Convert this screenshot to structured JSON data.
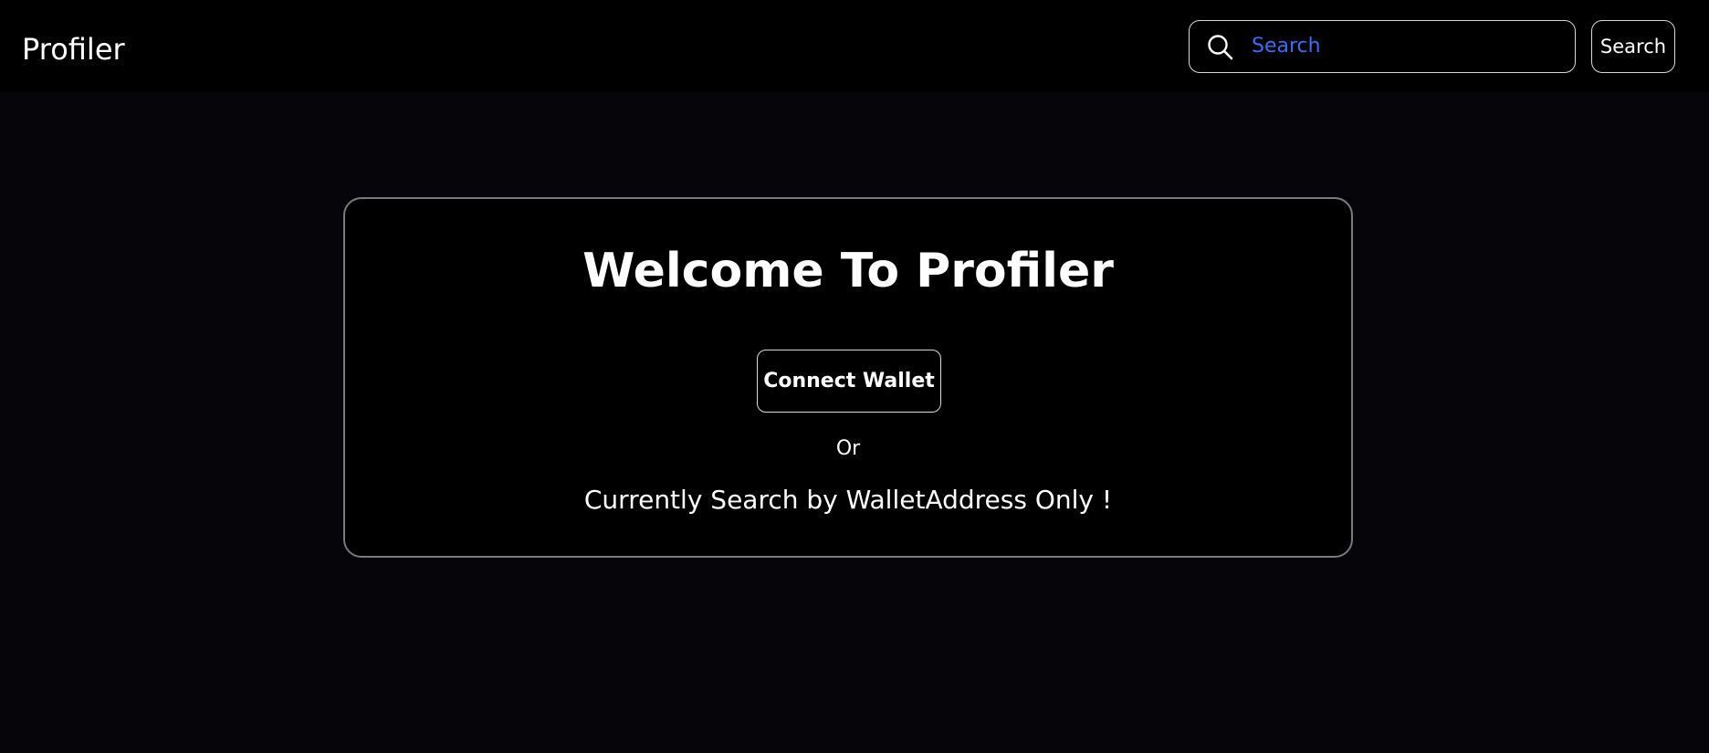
{
  "navbar": {
    "brand": "Profiler",
    "search": {
      "placeholder": "Search",
      "value": "",
      "icon": "search-icon",
      "placeholder_color": "#3b6df5"
    },
    "search_button_label": "Search"
  },
  "welcome": {
    "title": "Welcome To Profiler",
    "connect_button_label": "Connect Wallet",
    "or_text": "Or",
    "info_text": "Currently Search by WalletAddress Only !"
  },
  "colors": {
    "page_background": "#05050a",
    "navbar_background": "#000000",
    "card_border": "#7a7a80",
    "text": "#ffffff"
  }
}
